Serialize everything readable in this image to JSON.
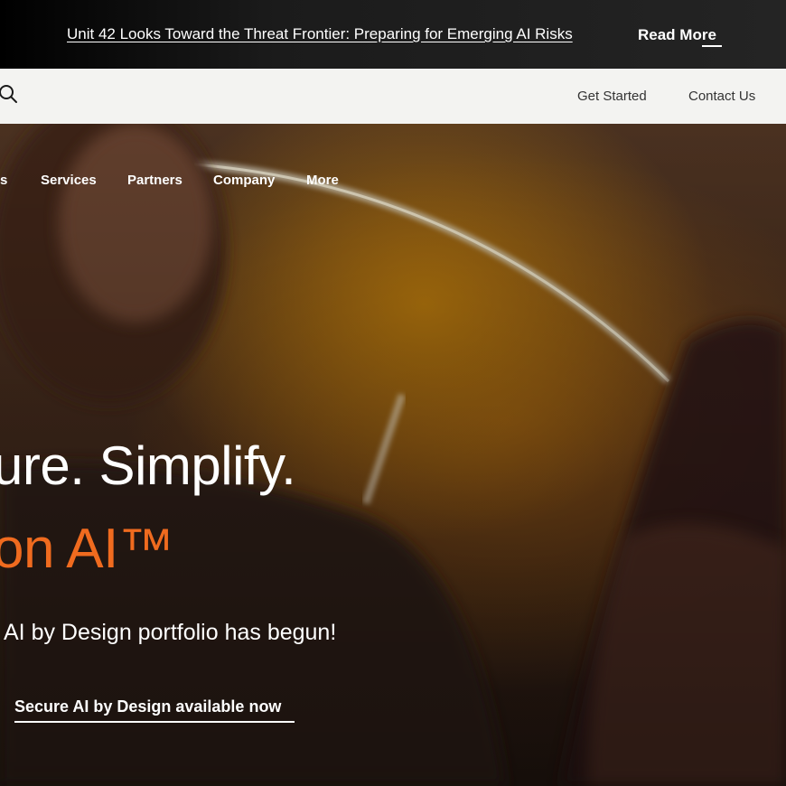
{
  "announcement": {
    "headline": "Unit 42 Looks Toward the Threat Frontier: Preparing for Emerging AI Risks",
    "cta": "Read More"
  },
  "utility_nav": {
    "search_icon": "search-icon",
    "get_started": "Get Started",
    "contact_us": "Contact Us"
  },
  "main_nav": {
    "items": [
      "s",
      "Services",
      "Partners",
      "Company",
      "More"
    ]
  },
  "hero": {
    "headline_line1": "ure. Simplify.",
    "headline_line2": "on AI™",
    "headline_line2_color": "#f06b1f",
    "subheading": "AI by Design portfolio has begun!",
    "cta": "Secure AI by Design available now"
  },
  "colors": {
    "announcement_bg": "#1b1b1b",
    "utility_bg": "#f3f3f1",
    "accent_orange": "#f06b1f"
  }
}
